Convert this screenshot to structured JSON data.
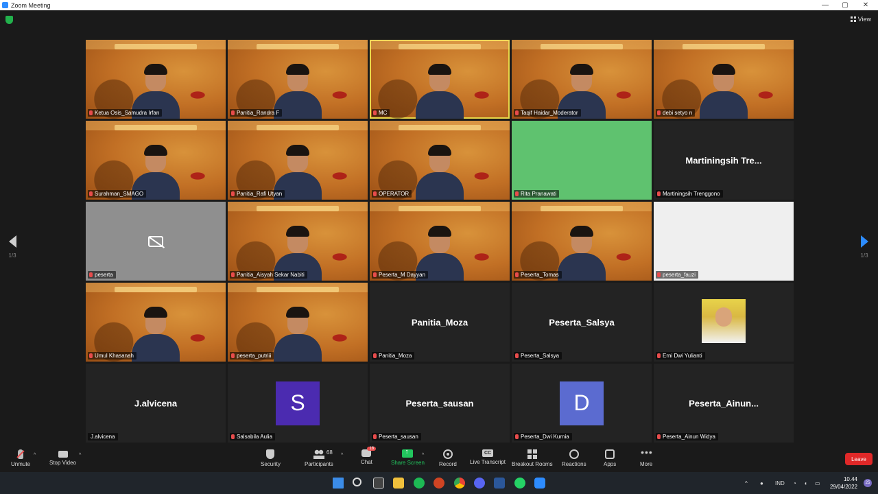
{
  "window": {
    "title": "Zoom Meeting",
    "controls": [
      "—",
      "▢",
      "✕"
    ]
  },
  "top": {
    "view_label": "View"
  },
  "pager": {
    "left_label": "1/3",
    "right_label": "1/3"
  },
  "tiles": [
    {
      "name": "Ketua Osis_Samudra Irfan",
      "type": "video",
      "muted": true
    },
    {
      "name": "Panitia_Randra F",
      "type": "video",
      "muted": true
    },
    {
      "name": "MC",
      "type": "video",
      "muted": true,
      "active": true
    },
    {
      "name": "Taqif Haidar_Moderator",
      "type": "video",
      "muted": true
    },
    {
      "name": "debi setyo n",
      "type": "video",
      "muted": true
    },
    {
      "name": "Surahman_SMAGO",
      "type": "video",
      "muted": true
    },
    {
      "name": "Panitia_Rafi Utyan",
      "type": "video",
      "muted": true
    },
    {
      "name": "OPERATOR",
      "type": "video",
      "muted": true
    },
    {
      "name": "Rita Pranawati",
      "type": "video-green",
      "muted": true
    },
    {
      "name": "Martiningsih Trenggono",
      "type": "name",
      "display": "Martiningsih  Tre...",
      "muted": true
    },
    {
      "name": "peserta",
      "type": "camoff",
      "muted": true
    },
    {
      "name": "Panitia_Aisyah Sekar Nabiti",
      "type": "video",
      "muted": true
    },
    {
      "name": "Peserta_M Dayyan",
      "type": "video",
      "muted": true
    },
    {
      "name": "Peserta_Tomas",
      "type": "video",
      "muted": true
    },
    {
      "name": "peserta_fauzi",
      "type": "video-white",
      "muted": true
    },
    {
      "name": "Umul Khasanah",
      "type": "video",
      "muted": true
    },
    {
      "name": "peserta_putriii",
      "type": "video",
      "muted": true
    },
    {
      "name": "Panitia_Moza",
      "type": "name",
      "display": "Panitia_Moza",
      "muted": true
    },
    {
      "name": "Peserta_Salsya",
      "type": "name",
      "display": "Peserta_Salsya",
      "muted": true
    },
    {
      "name": "Erni Dwi Yulianti",
      "type": "photo",
      "muted": true
    },
    {
      "name": "J.alvicena",
      "type": "name",
      "display": "J.alvicena",
      "muted": false
    },
    {
      "name": "Salsabila Aulia",
      "type": "letter",
      "letter": "S",
      "color": "#4b2bb0",
      "muted": true
    },
    {
      "name": "Peserta_sausan",
      "type": "name",
      "display": "Peserta_sausan",
      "muted": true
    },
    {
      "name": "Peserta_Dwi Kurnia",
      "type": "letter",
      "letter": "D",
      "color": "#5b6bd0",
      "muted": true
    },
    {
      "name": "Peserta_Ainun Widya",
      "type": "name",
      "display": "Peserta_Ainun...",
      "muted": true
    }
  ],
  "toolbar": {
    "unmute": "Unmute",
    "stop_video": "Stop Video",
    "security": "Security",
    "participants": "Participants",
    "participants_count": "68",
    "chat": "Chat",
    "chat_badge": "18",
    "share_screen": "Share Screen",
    "record": "Record",
    "live_transcript": "Live Transcript",
    "live_transcript_icon": "CC",
    "breakout_rooms": "Breakout Rooms",
    "reactions": "Reactions",
    "apps": "Apps",
    "more": "More",
    "leave": "Leave"
  },
  "taskbar": {
    "language": "IND",
    "time": "10.44",
    "date": "29/04/2022",
    "notifications": "25"
  }
}
